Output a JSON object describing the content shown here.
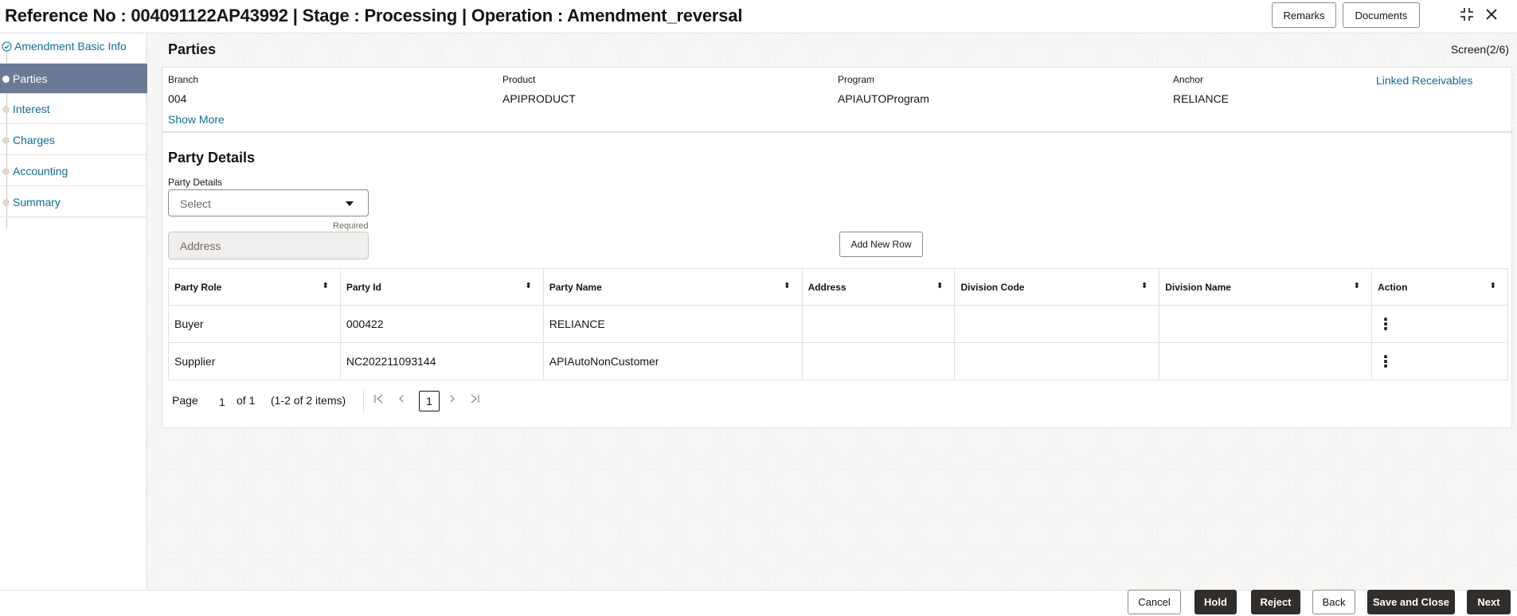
{
  "header": {
    "title": "Reference No : 004091122AP43992 | Stage : Processing | Operation : Amendment_reversal",
    "remarks_label": "Remarks",
    "documents_label": "Documents"
  },
  "sidebar": {
    "items": [
      {
        "label": "Amendment Basic Info"
      },
      {
        "label": "Parties"
      },
      {
        "label": "Interest"
      },
      {
        "label": "Charges"
      },
      {
        "label": "Accounting"
      },
      {
        "label": "Summary"
      }
    ]
  },
  "main": {
    "title": "Parties",
    "screen": "Screen(2/6)",
    "info": {
      "branch": {
        "label": "Branch",
        "value": "004"
      },
      "product": {
        "label": "Product",
        "value": "APIPRODUCT"
      },
      "program": {
        "label": "Program",
        "value": "APIAUTOProgram"
      },
      "anchor": {
        "label": "Anchor",
        "value": "RELIANCE"
      },
      "linked_label": "Linked Receivables",
      "show_more": "Show More"
    },
    "party": {
      "section_title": "Party Details",
      "field_label": "Party Details",
      "select_placeholder": "Select",
      "required": "Required",
      "address_placeholder": "Address",
      "add_row_label": "Add New Row",
      "columns": [
        "Party Role",
        "Party Id",
        "Party Name",
        "Address",
        "Division Code",
        "Division Name",
        "Action"
      ],
      "rows": [
        {
          "role": "Buyer",
          "id": "000422",
          "name": "RELIANCE",
          "address": "",
          "division_code": "",
          "division_name": ""
        },
        {
          "role": "Supplier",
          "id": "NC202211093144",
          "name": "APIAutoNonCustomer",
          "address": "",
          "division_code": "",
          "division_name": ""
        }
      ]
    },
    "pager": {
      "page_label": "Page",
      "page": "1",
      "of": "of 1",
      "items": "(1-2 of 2 items)",
      "current": "1"
    }
  },
  "footer": {
    "cancel": "Cancel",
    "hold": "Hold",
    "reject": "Reject",
    "back": "Back",
    "save_close": "Save and Close",
    "next": "Next"
  },
  "colors": {
    "accent_link": "#0f6e96",
    "active_nav": "#6b7896",
    "dark_button": "#312d2a"
  }
}
